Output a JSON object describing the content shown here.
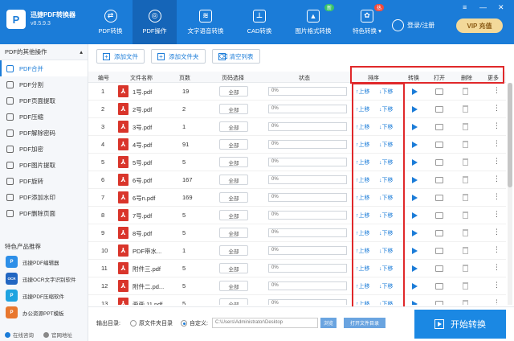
{
  "app": {
    "logo_letter": "P",
    "name": "迅捷PDF转换器",
    "version": "v8.5.9.3"
  },
  "nav": [
    {
      "label": "PDF转换",
      "icon": "convert-icon",
      "badge": ""
    },
    {
      "label": "PDF操作",
      "icon": "pdf-operation-icon",
      "badge": ""
    },
    {
      "label": "文字语音转换",
      "icon": "audio-wave-icon",
      "badge": ""
    },
    {
      "label": "CAD转换",
      "icon": "cad-icon",
      "badge": ""
    },
    {
      "label": "图片格式转换",
      "icon": "image-icon",
      "badge": "新"
    },
    {
      "label": "特色转换 ▾",
      "icon": "special-icon",
      "badge": "热"
    }
  ],
  "window_controls": {
    "menu": "≡",
    "minimize": "—",
    "close": "✕"
  },
  "account": {
    "login_label": "登录/注册",
    "vip_label": "VIP 充值"
  },
  "sidebar": {
    "header": "PDF的其他操作",
    "collapse": "▴",
    "items": [
      {
        "label": "PDF合并"
      },
      {
        "label": "PDF分割"
      },
      {
        "label": "PDF页面提取"
      },
      {
        "label": "PDF压缩"
      },
      {
        "label": "PDF解除密码"
      },
      {
        "label": "PDF加密"
      },
      {
        "label": "PDF图片提取"
      },
      {
        "label": "PDF旋转"
      },
      {
        "label": "PDF添加水印"
      },
      {
        "label": "PDF删除页面"
      }
    ],
    "featured_title": "特色产品推荐",
    "featured": [
      {
        "label": "迅捷PDF编辑器",
        "icon": "pdf-editor-icon",
        "mark": "P",
        "color": "#2d8fe8"
      },
      {
        "label": "迅捷OCR文字识别软件",
        "icon": "ocr-icon",
        "mark": "OCR",
        "color": "#2166c2"
      },
      {
        "label": "迅捷PDF压缩软件",
        "icon": "pdf-compress-icon",
        "mark": "P",
        "color": "#1ea3e0"
      },
      {
        "label": "办公资源PPT模板",
        "icon": "ppt-template-icon",
        "mark": "P",
        "color": "#e8772e"
      }
    ],
    "footer": {
      "online_consult": "在线咨询",
      "official_site": "官网地址"
    }
  },
  "toolbar": {
    "add_file": "添加文件",
    "add_folder": "添加文件夹",
    "clear_list": "清空列表"
  },
  "table": {
    "columns": {
      "index": "编号",
      "name": "文件名称",
      "pages": "页数",
      "range": "页码选择",
      "status": "状态",
      "sort": "排序",
      "convert": "转换",
      "open": "打开",
      "delete": "删除",
      "more": "更多"
    },
    "rows": [
      {
        "index": "1",
        "name": "1号.pdf",
        "pages": "19",
        "range": "全部",
        "progress": "0%",
        "up": "↑上移",
        "down": "↓下移"
      },
      {
        "index": "2",
        "name": "2号.pdf",
        "pages": "2",
        "range": "全部",
        "progress": "0%",
        "up": "↑上移",
        "down": "↓下移"
      },
      {
        "index": "3",
        "name": "3号.pdf",
        "pages": "1",
        "range": "全部",
        "progress": "0%",
        "up": "↑上移",
        "down": "↓下移"
      },
      {
        "index": "4",
        "name": "4号.pdf",
        "pages": "91",
        "range": "全部",
        "progress": "0%",
        "up": "↑上移",
        "down": "↓下移"
      },
      {
        "index": "5",
        "name": "5号.pdf",
        "pages": "5",
        "range": "全部",
        "progress": "0%",
        "up": "↑上移",
        "down": "↓下移"
      },
      {
        "index": "6",
        "name": "6号.pdf",
        "pages": "167",
        "range": "全部",
        "progress": "0%",
        "up": "↑上移",
        "down": "↓下移"
      },
      {
        "index": "7",
        "name": "6号n.pdf",
        "pages": "169",
        "range": "全部",
        "progress": "0%",
        "up": "↑上移",
        "down": "↓下移"
      },
      {
        "index": "8",
        "name": "7号.pdf",
        "pages": "5",
        "range": "全部",
        "progress": "0%",
        "up": "↑上移",
        "down": "↓下移"
      },
      {
        "index": "9",
        "name": "8号.pdf",
        "pages": "5",
        "range": "全部",
        "progress": "0%",
        "up": "↑上移",
        "down": "↓下移"
      },
      {
        "index": "10",
        "name": "PDF带水...",
        "pages": "1",
        "range": "全部",
        "progress": "0%",
        "up": "↑上移",
        "down": "↓下移"
      },
      {
        "index": "11",
        "name": "附件三.pdf",
        "pages": "5",
        "range": "全部",
        "progress": "0%",
        "up": "↑上移",
        "down": "↓下移"
      },
      {
        "index": "12",
        "name": "附件二.pd...",
        "pages": "5",
        "range": "全部",
        "progress": "0%",
        "up": "↑上移",
        "down": "↓下移"
      },
      {
        "index": "13",
        "name": "画画 11.pdf",
        "pages": "5",
        "range": "全部",
        "progress": "0%",
        "up": "↑上移",
        "down": "↓下移"
      }
    ],
    "more_glyph": "⋮",
    "pdf_glyph": "⅄"
  },
  "footer": {
    "output_label": "输出目录:",
    "option_source": "原文件夹目录",
    "option_custom": "自定义:",
    "selected_option": "自定义",
    "path": "C:\\Users\\Administrator\\Desktop",
    "browse": "浏览",
    "open_folder": "打开文件目录",
    "start_button": "开始转换"
  },
  "colors": {
    "brand": "#1b7cd8",
    "highlight": "#e0282a",
    "pdf_icon": "#d9352b"
  }
}
